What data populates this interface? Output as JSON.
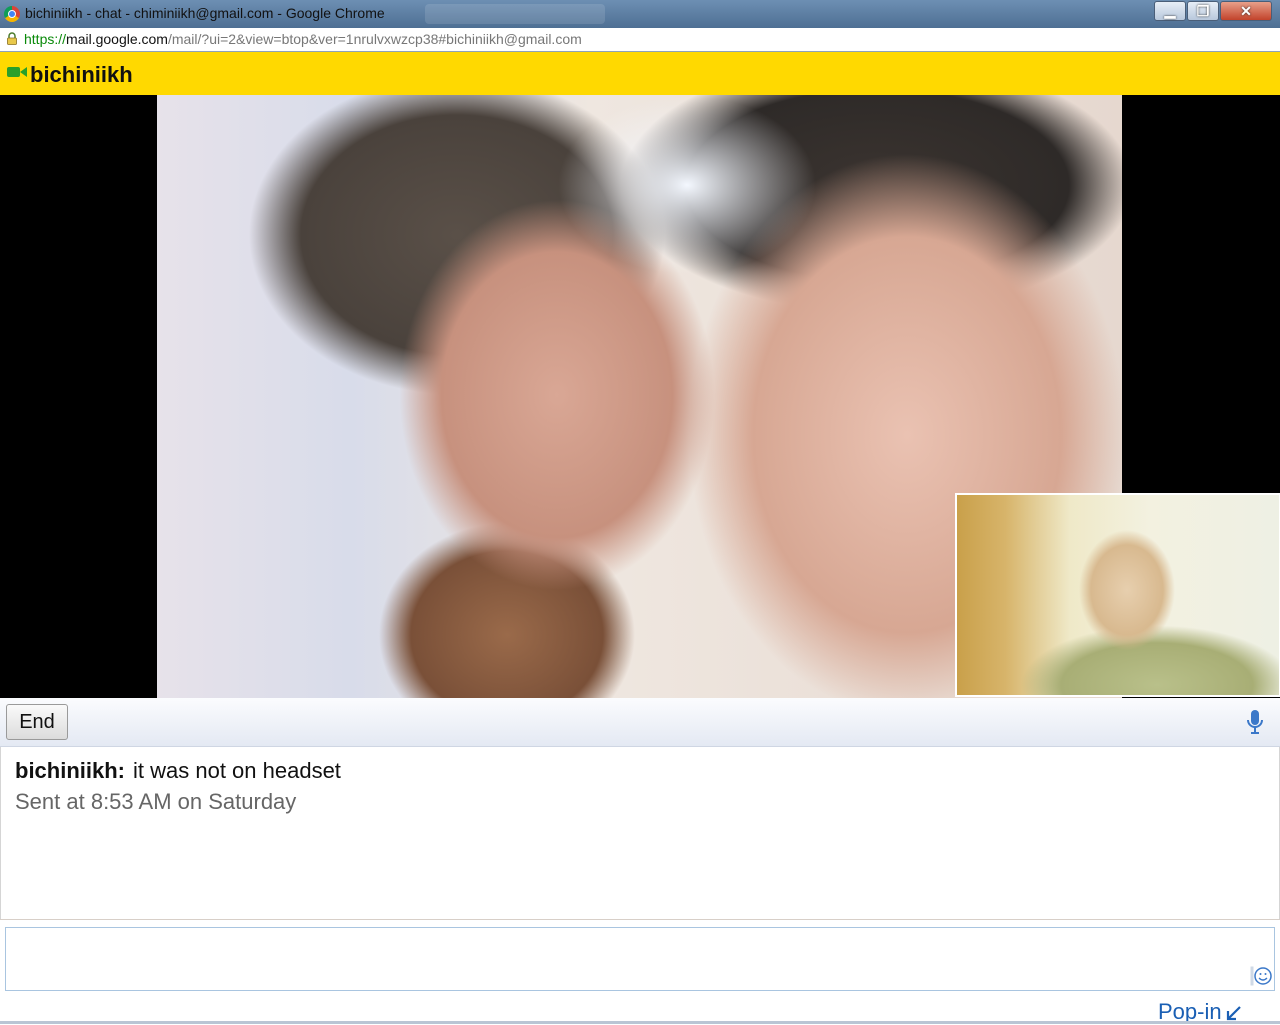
{
  "window": {
    "title": "bichiniikh - chat - chiminiikh@gmail.com - Google Chrome"
  },
  "address_bar": {
    "scheme": "https://",
    "host": "mail.google.com",
    "path": "/mail/?ui=2&view=btop&ver=1nrulvxwzcp38#bichiniikh@gmail.com"
  },
  "chat_header": {
    "contact_name": "bichiniikh"
  },
  "controls": {
    "end_label": "End"
  },
  "messages": [
    {
      "sender": "bichiniikh:",
      "text": "it was not on headset",
      "timestamp": "Sent at 8:53 AM on Saturday"
    }
  ],
  "input": {
    "value": "",
    "placeholder": ""
  },
  "footer": {
    "popin_label": "Pop-in"
  },
  "colors": {
    "header_yellow": "#ffd900",
    "link_blue": "#1a5fb4",
    "secure_green": "#0a8a0a"
  },
  "icons": [
    "chrome-icon",
    "lock-icon",
    "video-camera-icon",
    "microphone-icon",
    "emoticon-icon",
    "popin-arrow-icon",
    "minimize-icon",
    "maximize-icon",
    "close-icon"
  ]
}
